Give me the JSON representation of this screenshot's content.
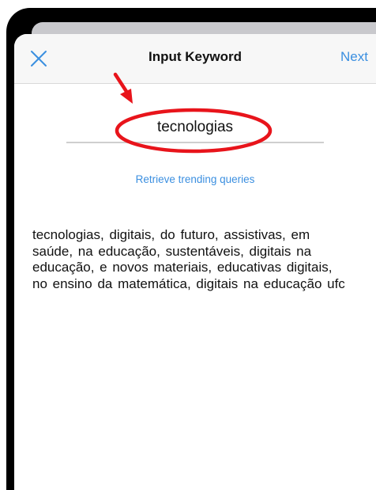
{
  "nav": {
    "close_icon": "close-x-icon",
    "title": "Input Keyword",
    "next_label": "Next"
  },
  "keyword": {
    "value": "tecnologias"
  },
  "retrieve": {
    "label": "Retrieve trending queries"
  },
  "results": {
    "text": "tecnologias,  digitais,  do futuro,  assistivas, em saúde,  na educação,  sustentáveis, digitais na educação,  e novos materiais, educativas digitais,  no ensino da matemática,  digitais na educação ufc"
  },
  "annotation": {
    "arrow_icon": "red-arrow-icon",
    "ellipse_icon": "red-ellipse-highlight",
    "color": "#e8141b"
  },
  "colors": {
    "accent": "#3b8fe0",
    "nav_background": "#f7f7f7",
    "frame": "#000000"
  }
}
